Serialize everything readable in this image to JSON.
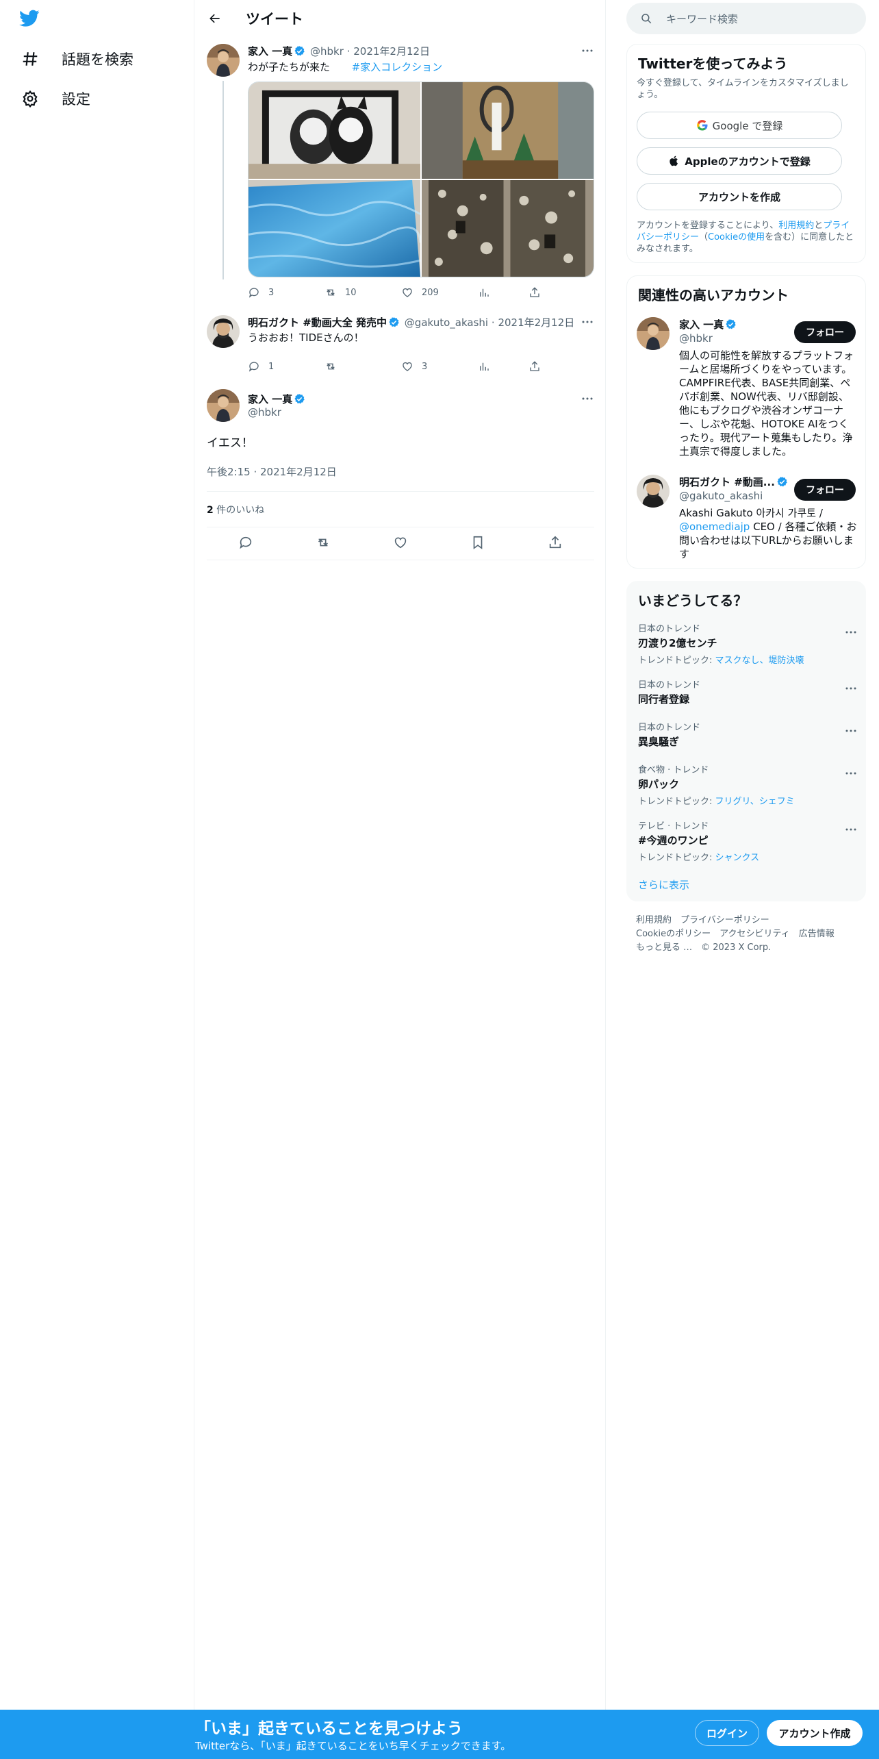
{
  "nav": {
    "logo_icon": "twitter-bird-icon",
    "items": [
      {
        "icon": "hashtag-icon",
        "label": "話題を検索"
      },
      {
        "icon": "gear-icon",
        "label": "設定"
      }
    ]
  },
  "header": {
    "title": "ツイート"
  },
  "parent_tweet": {
    "name": "家入 一真",
    "handle": "@hbkr",
    "sep": "·",
    "date": "2021年2月12日",
    "text": "わが子たちが来た",
    "hashtag": "#家入コレクション",
    "replies": "3",
    "retweets": "10",
    "likes": "209"
  },
  "reply_tweet": {
    "name": "明石ガクト #動画大全 発売中",
    "handle": "@gakuto_akashi",
    "sep": "·",
    "date": "2021年2月12日",
    "text": "うおおお！TIDEさんの！",
    "replies": "1",
    "retweets": "",
    "likes": "3"
  },
  "focus_tweet": {
    "name": "家入 一真",
    "handle": "@hbkr",
    "text": "イエス！",
    "timestamp": "午後2:15 · 2021年2月12日",
    "like_count": "2",
    "like_label": " 件のいいね"
  },
  "search": {
    "placeholder": "キーワード検索"
  },
  "signup": {
    "title": "Twitterを使ってみよう",
    "subtitle": "今すぐ登録して、タイムラインをカスタマイズしましょう。",
    "google": "Google で登録",
    "apple": "Appleのアカウントで登録",
    "create": "アカウントを作成",
    "terms_pre": "アカウントを登録することにより、",
    "terms_link": "利用規約",
    "terms_and": "と",
    "privacy_link": "プライバシーポリシー",
    "cookie_pre": "（",
    "cookie_link": "Cookieの使用",
    "terms_post": "を含む）に同意したとみなされます。"
  },
  "related": {
    "title": "関連性の高いアカウント",
    "follow": "フォロー",
    "accounts": [
      {
        "name": "家入 一真",
        "handle": "@hbkr",
        "bio": "個人の可能性を解放するプラットフォームと居場所づくりをやっています。CAMPFIRE代表、BASE共同創業、ペパボ創業、NOW代表、リバ邸創設、他にもブクログや渋谷オンザコーナー、しぶや花魁、HOTOKE AIをつくったり。現代アート蒐集もしたり。浄土真宗で得度しました。"
      },
      {
        "name": "明石ガクト #動画...",
        "handle": "@gakuto_akashi",
        "bio_pre": "Akashi Gakuto 아카시 가쿠토 / ",
        "bio_link": "@onemediajp",
        "bio_post": " CEO / 各種ご依頼・お問い合わせは以下URLからお願いします"
      }
    ]
  },
  "trends": {
    "title": "いまどうしてる？",
    "topics_label": "トレンドトピック: ",
    "items": [
      {
        "category": "日本のトレンド",
        "name": "刃渡り2億センチ",
        "topics": "マスクなし、堤防決壊"
      },
      {
        "category": "日本のトレンド",
        "name": "同行者登録",
        "topics": ""
      },
      {
        "category": "日本のトレンド",
        "name": "異臭騒ぎ",
        "topics": ""
      },
      {
        "category": "食べ物 · トレンド",
        "name": "卵パック",
        "topics": "フリグリ、シェフミ"
      },
      {
        "category": "テレビ · トレンド",
        "name": "#今週のワンピ",
        "topics": "シャンクス"
      }
    ],
    "show_more": "さらに表示"
  },
  "footer": {
    "line1": "利用規約　プライバシーポリシー",
    "line2": "Cookieのポリシー　アクセシビリティ　広告情報",
    "line3": "もっと見る …　© 2023 X Corp."
  },
  "bottom_bar": {
    "title": "「いま」起きていることを見つけよう",
    "subtitle": "Twitterなら、「いま」起きていることをいち早くチェックできます。",
    "login": "ログイン",
    "signup": "アカウント作成"
  },
  "colors": {
    "accent": "#1d9bf0",
    "text": "#0f1419",
    "secondary": "#536471"
  }
}
